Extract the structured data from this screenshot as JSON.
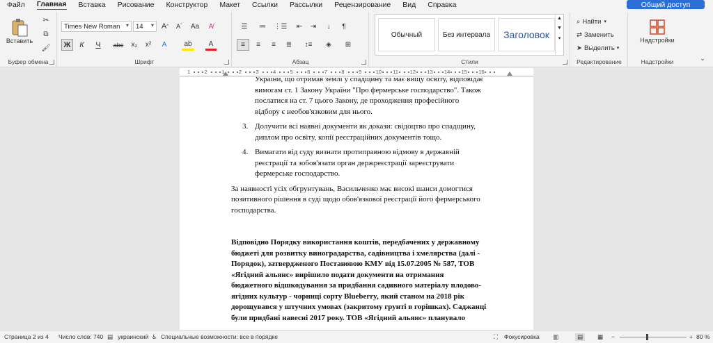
{
  "menu": [
    "Файл",
    "Главная",
    "Вставка",
    "Рисование",
    "Конструктор",
    "Макет",
    "Ссылки",
    "Рассылки",
    "Рецензирование",
    "Вид",
    "Справка"
  ],
  "menu_active": 1,
  "share_label": "Общий доступ",
  "clipboard": {
    "paste_label": "Вставить",
    "group_label": "Буфер обмена"
  },
  "font": {
    "name": "Times New Roman",
    "size": "14",
    "group_label": "Шрифт",
    "grow": "A",
    "shrink": "A",
    "case": "Aa",
    "bold": "Ж",
    "italic": "К",
    "underline": "Ч",
    "strike": "abc",
    "sub": "x₂",
    "sup": "x²",
    "highlight": "ab",
    "color": "A"
  },
  "paragraph": {
    "group_label": "Абзац"
  },
  "styles": {
    "group_label": "Стили",
    "items": [
      "Обычный",
      "Без интервала",
      "Заголовок"
    ]
  },
  "editing": {
    "group_label": "Редактирование",
    "find": "Найти",
    "replace": "Заменить",
    "select": "Выделить"
  },
  "addins": {
    "label": "Надстройки",
    "group_label": "Надстройки"
  },
  "ruler_numbers": [
    "1",
    "2",
    "1",
    "2",
    "3",
    "4",
    "5",
    "6",
    "7",
    "8",
    "9",
    "10",
    "11",
    "12",
    "13",
    "14",
    "15",
    "16"
  ],
  "document": {
    "lines_a": [
      "України, що отримав землі у спадщину та має вищу освіту, відповідає",
      "вимогам ст. 1 Закону України \"Про фермерське господарство\". Також",
      "послатися на ст. 7 цього Закону, де проходження професійного",
      "відбору є необов'язковим для нього."
    ],
    "item3_num": "3.",
    "item3": [
      "Долучити всі наявні документи як докази: свідоцтво про спадщину,",
      "диплом про освіту, копії реєстраційних документів тощо."
    ],
    "item4_num": "4.",
    "item4": [
      "Вимагати від суду визнати протиправною відмову в державній",
      "реєстрації та зобов'язати орган держреєстрації зареєструвати",
      "фермерське господарство."
    ],
    "conclusion": [
      "За наявності усіх обгрунтувань, Васильченко має високі шанси домогтися",
      "позитивного рішення в суді щодо обов'язкової реєстрації його фермерського",
      "господарства."
    ],
    "bold_para": [
      "Відповідно Порядку використання коштів, передбачених у державному",
      "бюджеті для розвитку виноградарства, садівництва і хмелярства (далі -",
      "Порядок), затвердженого Постановою КМУ від 15.07.2005 № 587, ТОВ",
      "«Ягідний альянс» вирішило подати документи на отримання",
      "бюджетного відшкодування за придбання садивного матеріалу плодово-",
      "ягідних культур - чорниці сорту Blueberry, який станом на 2018 рік",
      "дорощувався у штучних умовах (закритому грунті в горішках). Саджанці",
      "були придбані навесні 2017 року. ТОВ «Ягідний альянс» планувало"
    ]
  },
  "status": {
    "page": "Страница 2 из 4",
    "words": "Число слов: 740",
    "lang": "украинский",
    "accessibility": "Специальные возможности: все в порядке",
    "focus": "Фокусировка",
    "zoom": "80 %"
  },
  "zoom_level": 0.8
}
